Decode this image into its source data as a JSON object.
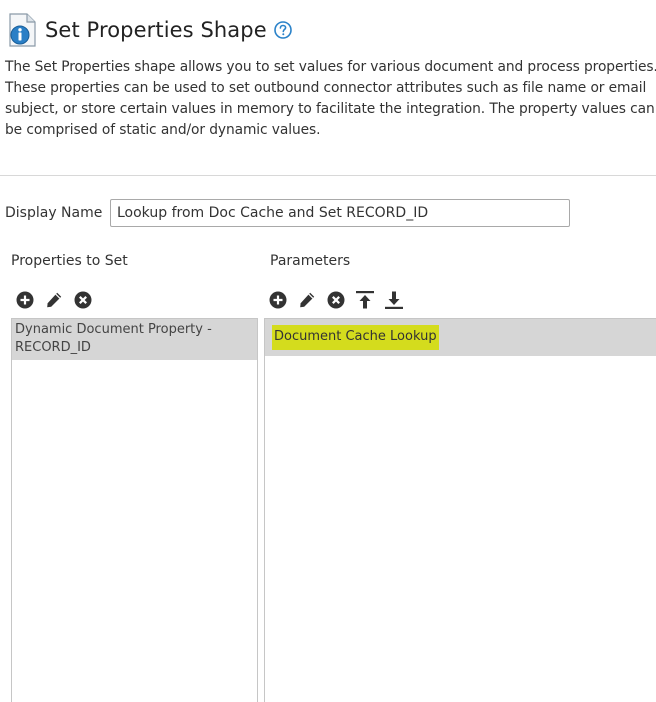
{
  "header": {
    "title": "Set Properties Shape",
    "icon": "document-info-icon",
    "help_icon": "help-icon",
    "accent_color": "#2a82c9"
  },
  "description": "The Set Properties shape allows you to set values for various document and process properties. These properties can be used to set outbound connector attributes such as file name or email subject, or store certain values in memory to facilitate the integration. The property values can be comprised of static and/or dynamic values.",
  "display_name": {
    "label": "Display Name",
    "value": "Lookup from Doc Cache and Set RECORD_ID"
  },
  "properties_panel": {
    "label": "Properties to Set",
    "toolbar": [
      "add-icon",
      "edit-icon",
      "remove-icon"
    ],
    "items": [
      {
        "line1": "Dynamic Document Property -",
        "line2": "RECORD_ID"
      }
    ]
  },
  "parameters_panel": {
    "label": "Parameters",
    "toolbar": [
      "add-icon",
      "edit-icon",
      "remove-icon",
      "move-up-icon",
      "move-down-icon"
    ],
    "items": [
      {
        "label": "Document Cache Lookup",
        "highlight_color": "#d4dc1d"
      }
    ]
  }
}
